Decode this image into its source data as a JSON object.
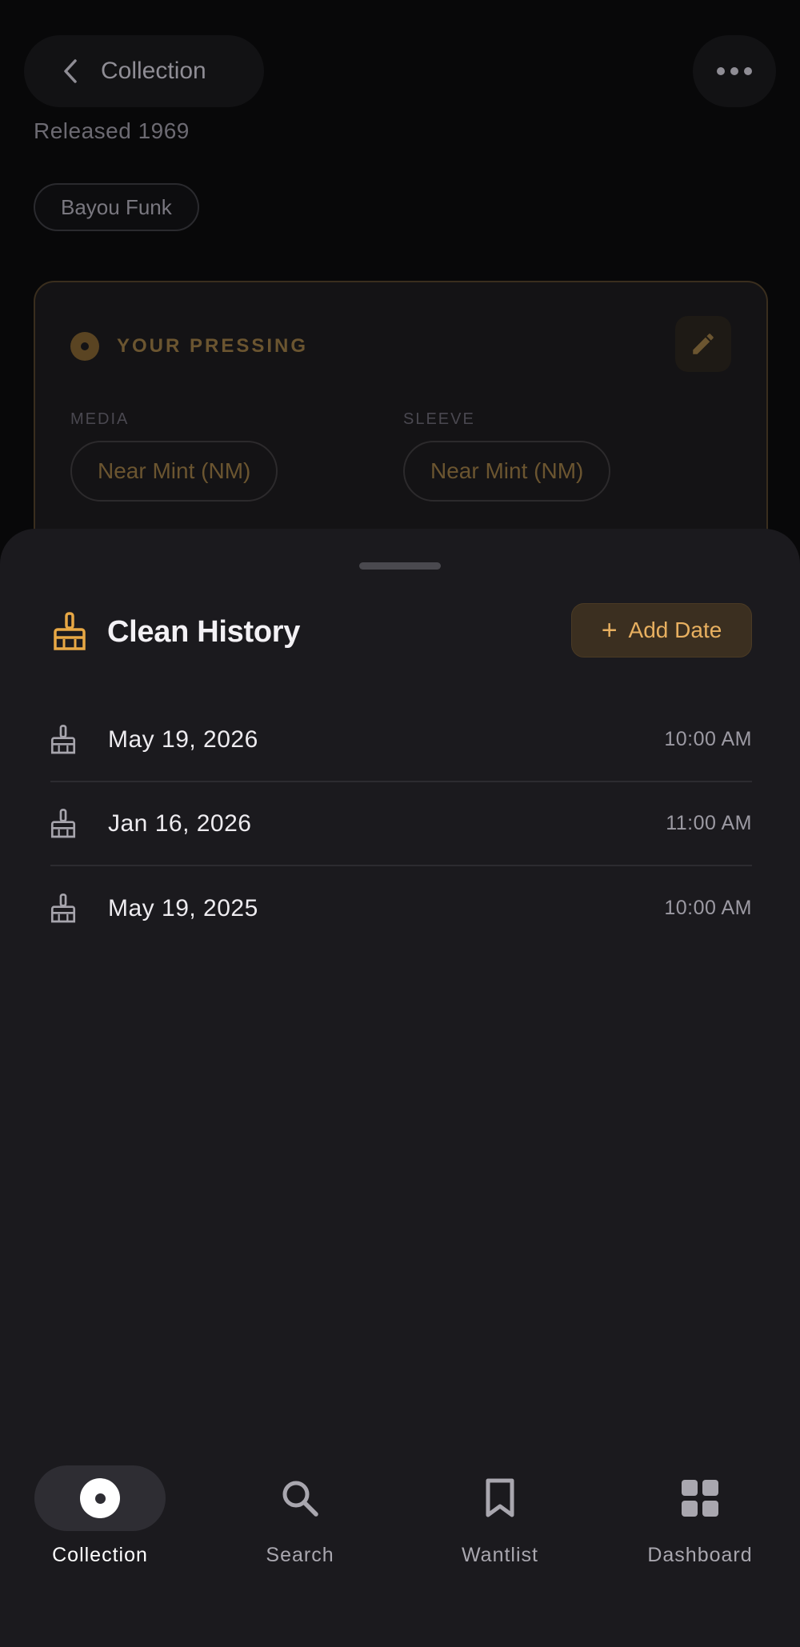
{
  "topbar": {
    "title": "Collection"
  },
  "album": {
    "released": "Released 1969",
    "genre": "Bayou Funk"
  },
  "pressing": {
    "title": "YOUR PRESSING",
    "media_label": "MEDIA",
    "media_value": "Near Mint (NM)",
    "sleeve_label": "SLEEVE",
    "sleeve_value": "Near Mint (NM)"
  },
  "sheet": {
    "title": "Clean History",
    "add_date_label": "Add Date",
    "history": [
      {
        "date": "May 19, 2026",
        "time": "10:00 AM"
      },
      {
        "date": "Jan 16, 2026",
        "time": "11:00 AM"
      },
      {
        "date": "May 19, 2025",
        "time": "10:00 AM"
      }
    ]
  },
  "nav": {
    "items": [
      {
        "label": "Collection",
        "icon": "vinyl-icon",
        "active": true
      },
      {
        "label": "Search",
        "icon": "search-icon",
        "active": false
      },
      {
        "label": "Wantlist",
        "icon": "bookmark-icon",
        "active": false
      },
      {
        "label": "Dashboard",
        "icon": "grid-icon",
        "active": false
      }
    ]
  },
  "colors": {
    "accent": "#e8b060",
    "sheet_bg": "#1b1a1e",
    "page_bg": "#080809"
  }
}
